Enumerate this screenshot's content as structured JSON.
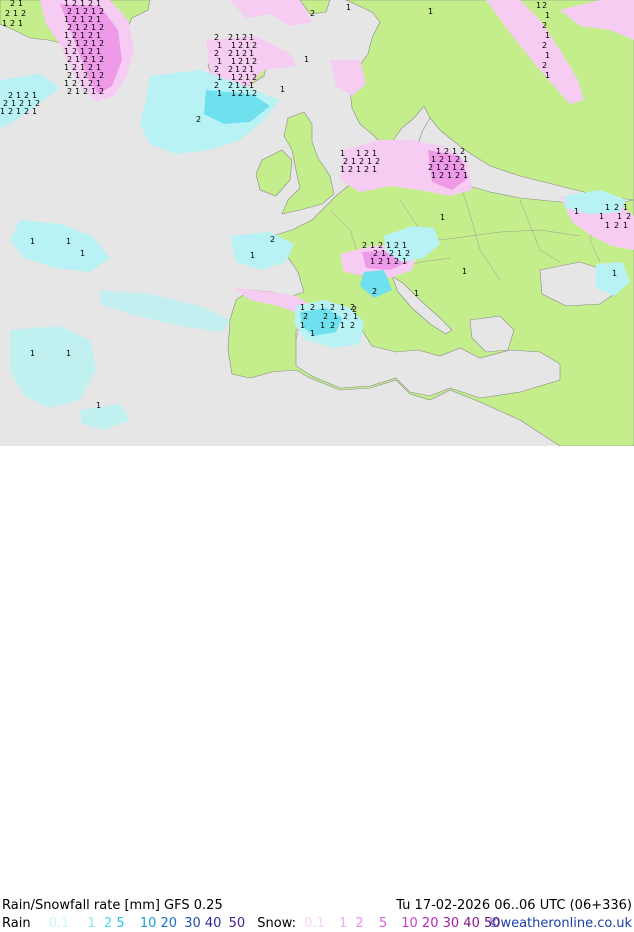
{
  "header": {
    "title": "Rain/Snowfall rate [mm] GFS 0.25",
    "datetime": "Tu 17-02-2026 06..06 UTC (06+336)"
  },
  "legend": {
    "rain_label": "Rain",
    "rain_levels": [
      {
        "label": "0.1",
        "color": "#c8f5f5"
      },
      {
        "label": "1",
        "color": "#8be8f0"
      },
      {
        "label": "2",
        "color": "#50d8e8"
      },
      {
        "label": "5",
        "color": "#28c3e6"
      },
      {
        "label": "10",
        "color": "#1e9be0"
      },
      {
        "label": "20",
        "color": "#1a70c8"
      },
      {
        "label": "30",
        "color": "#1a4db0"
      },
      {
        "label": "40",
        "color": "#2c2ca0"
      },
      {
        "label": "50",
        "color": "#441f8f"
      }
    ],
    "snow_label": "Snow:",
    "snow_levels": [
      {
        "label": "0.1",
        "color": "#f7d6f7"
      },
      {
        "label": "1",
        "color": "#f0b0f0"
      },
      {
        "label": "2",
        "color": "#e890e8"
      },
      {
        "label": "5",
        "color": "#e060e0"
      },
      {
        "label": "10",
        "color": "#d040d0"
      },
      {
        "label": "20",
        "color": "#b828b8"
      },
      {
        "label": "30",
        "color": "#a020a0"
      },
      {
        "label": "40",
        "color": "#881888"
      },
      {
        "label": "50",
        "color": "#701070"
      }
    ]
  },
  "credit": "©weatheronline.co.uk",
  "map": {
    "colors": {
      "sea": "#e6e6e6",
      "land": "#c4ee8c",
      "border": "#8a8a8a",
      "rain_light": "#b8f2f4",
      "rain_mid": "#6ee0ee",
      "snow_light": "#f7ccf2",
      "snow_mid": "#ee9ae8"
    },
    "rate_markers": [
      "1",
      "2"
    ]
  }
}
